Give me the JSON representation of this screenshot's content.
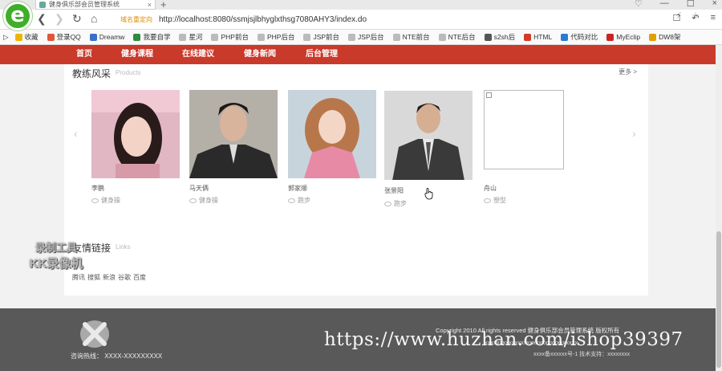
{
  "browser": {
    "logo_letter": "e",
    "tab_title": "健身俱乐部会员管理系统",
    "tab_close": "×",
    "new_tab": "+",
    "window_buttons": [
      "♡",
      "—",
      "☐",
      "×"
    ],
    "nav_back": "❮",
    "nav_forward": "❯",
    "nav_reload": "↻",
    "nav_home": "⌂",
    "address_mode": "域名重定向",
    "url": "http://localhost:8080/ssmjsjlbhyglxthsg7080AHY3/index.do",
    "addr_tools": [
      "☐",
      "↶",
      "≡"
    ],
    "bookmarks": [
      {
        "label": "收藏",
        "color": "#f0b400"
      },
      {
        "label": "登录QQ",
        "color": "#e0553a"
      },
      {
        "label": "Dreamw",
        "color": "#3a6fc9"
      },
      {
        "label": "我要自学",
        "color": "#2d8c3c"
      },
      {
        "label": "星河",
        "color": "#bbb"
      },
      {
        "label": "PHP前台",
        "color": "#bbb"
      },
      {
        "label": "PHP后台",
        "color": "#bbb"
      },
      {
        "label": "JSP前台",
        "color": "#bbb"
      },
      {
        "label": "JSP后台",
        "color": "#bbb"
      },
      {
        "label": "NTE前台",
        "color": "#bbb"
      },
      {
        "label": "NTE后台",
        "color": "#bbb"
      },
      {
        "label": "s2sh后",
        "color": "#555"
      },
      {
        "label": "HTML",
        "color": "#d43a2a"
      },
      {
        "label": "代码对比",
        "color": "#2a7ad4"
      },
      {
        "label": "MyEclip",
        "color": "#c22"
      },
      {
        "label": "DW8架",
        "color": "#e0a000"
      }
    ]
  },
  "site_nav": {
    "items": [
      "首页",
      "健身课程",
      "在线建议",
      "健身新闻",
      "后台管理"
    ]
  },
  "coaches": {
    "title": "教练风采",
    "subtitle": "Products",
    "more": "更多 >",
    "prev_arrow": "‹",
    "next_arrow": "›",
    "items": [
      {
        "name": "李鹏",
        "type": "健身操"
      },
      {
        "name": "马天俩",
        "type": "健身操"
      },
      {
        "name": "郭家顺",
        "type": "跑步"
      },
      {
        "name": "张景阳",
        "type": "跑步"
      },
      {
        "name": "舟山",
        "type": "塑型"
      }
    ]
  },
  "links": {
    "title": "友情链接",
    "subtitle": "Links",
    "items": [
      "腾讯",
      "搜狐",
      "新浪",
      "谷歌",
      "百度"
    ]
  },
  "footer": {
    "hotline": "咨询热线： XXXX-XXXXXXXXX",
    "copyright": "Copyright 2010 All rights reserved 健身俱乐部会员管理系统 版权所有",
    "line2": "xxxxxxxxxxxxxxxxxxxxxxxxxxxxxxx",
    "line3": "xxxx备xxxxxx号-1 技术支持：xxxxxxxx",
    "watermark": "https://www.huzhan.com/ishop39397"
  },
  "recorder": {
    "line1": "录制工具",
    "line2": "KK录像机"
  },
  "colors": {
    "nav_bg": "#c93a2b",
    "footer_bg": "#595959"
  }
}
